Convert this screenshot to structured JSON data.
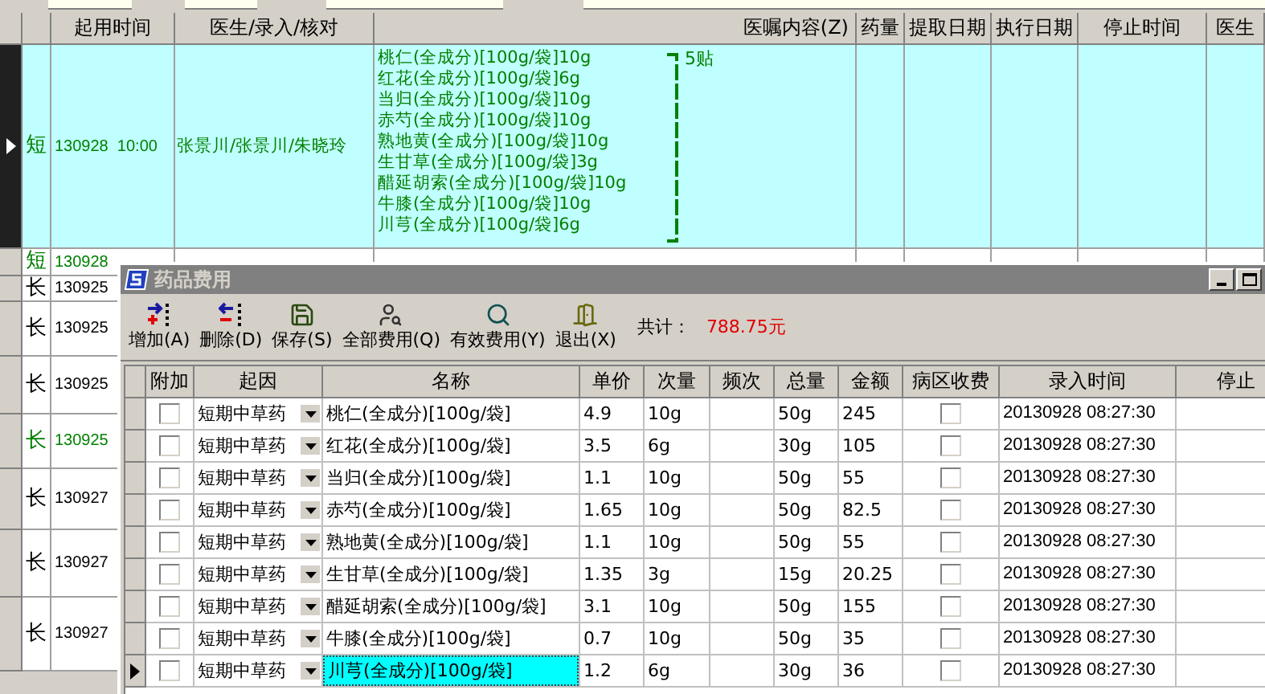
{
  "background_table": {
    "columns": [
      "起用时间",
      "医生/录入/核对",
      "医嘱内容(Z)",
      "药量",
      "提取日期",
      "执行日期",
      "停止时间",
      "医生"
    ],
    "rows": [
      {
        "selected": true,
        "color": "#008000",
        "type": "短",
        "start_time": "130928  10:00",
        "doctor": "张景川/张景川/朱晓玲",
        "content": [
          "桃仁(全成分)[100g/袋]10g",
          "红花(全成分)[100g/袋]6g",
          "当归(全成分)[100g/袋]10g",
          "赤芍(全成分)[100g/袋]10g",
          "熟地黄(全成分)[100g/袋]10g",
          "生甘草(全成分)[100g/袋]3g",
          "醋延胡索(全成分)[100g/袋]10g",
          "牛膝(全成分)[100g/袋]10g",
          "川芎(全成分)[100g/袋]6g"
        ],
        "doses": "5贴"
      },
      {
        "selected": false,
        "color": "#008000",
        "type": "短",
        "start_time": "130928"
      },
      {
        "selected": false,
        "color": "#000000",
        "type": "长",
        "start_time": "130925"
      },
      {
        "selected": false,
        "color": "#000000",
        "type": "长",
        "start_time": "130925"
      },
      {
        "selected": false,
        "color": "#000000",
        "type": "长",
        "start_time": "130925"
      },
      {
        "selected": false,
        "color": "#008000",
        "type": "长",
        "start_time": "130925"
      },
      {
        "selected": false,
        "color": "#000000",
        "type": "长",
        "start_time": "130927"
      },
      {
        "selected": false,
        "color": "#000000",
        "type": "长",
        "start_time": "130927"
      },
      {
        "selected": false,
        "color": "#000000",
        "type": "长",
        "start_time": "130927"
      }
    ]
  },
  "dialog": {
    "title": "药品费用",
    "toolbar": [
      {
        "kind": "add",
        "label": "增加(A)"
      },
      {
        "kind": "remove",
        "label": "删除(D)"
      },
      {
        "kind": "save",
        "label": "保存(S)"
      },
      {
        "kind": "all",
        "label": "全部费用(Q)"
      },
      {
        "kind": "valid",
        "label": "有效费用(Y)"
      },
      {
        "kind": "exit",
        "label": "退出(X)"
      }
    ],
    "total_label": "共计：",
    "total_value": "788.75元",
    "table": {
      "columns": [
        "附加",
        "起因",
        "名称",
        "单价",
        "次量",
        "频次",
        "总量",
        "金额",
        "病区收费",
        "录入时间",
        "停止"
      ],
      "rows": [
        {
          "selected": false,
          "attached": false,
          "cause": "短期中草药",
          "name": "桃仁(全成分)[100g/袋]",
          "price": "4.9",
          "dose": "10g",
          "total": "50g",
          "amount": "245",
          "ward_charge": false,
          "entered": "20130928 08:27:30"
        },
        {
          "selected": false,
          "attached": false,
          "cause": "短期中草药",
          "name": "红花(全成分)[100g/袋]",
          "price": "3.5",
          "dose": "6g",
          "total": "30g",
          "amount": "105",
          "ward_charge": false,
          "entered": "20130928 08:27:30"
        },
        {
          "selected": false,
          "attached": false,
          "cause": "短期中草药",
          "name": "当归(全成分)[100g/袋]",
          "price": "1.1",
          "dose": "10g",
          "total": "50g",
          "amount": "55",
          "ward_charge": false,
          "entered": "20130928 08:27:30"
        },
        {
          "selected": false,
          "attached": false,
          "cause": "短期中草药",
          "name": "赤芍(全成分)[100g/袋]",
          "price": "1.65",
          "dose": "10g",
          "total": "50g",
          "amount": "82.5",
          "ward_charge": false,
          "entered": "20130928 08:27:30"
        },
        {
          "selected": false,
          "attached": false,
          "cause": "短期中草药",
          "name": "熟地黄(全成分)[100g/袋]",
          "price": "1.1",
          "dose": "10g",
          "total": "50g",
          "amount": "55",
          "ward_charge": false,
          "entered": "20130928 08:27:30"
        },
        {
          "selected": false,
          "attached": false,
          "cause": "短期中草药",
          "name": "生甘草(全成分)[100g/袋]",
          "price": "1.35",
          "dose": "3g",
          "total": "15g",
          "amount": "20.25",
          "ward_charge": false,
          "entered": "20130928 08:27:30"
        },
        {
          "selected": false,
          "attached": false,
          "cause": "短期中草药",
          "name": "醋延胡索(全成分)[100g/袋]",
          "price": "3.1",
          "dose": "10g",
          "total": "50g",
          "amount": "155",
          "ward_charge": false,
          "entered": "20130928 08:27:30"
        },
        {
          "selected": false,
          "attached": false,
          "cause": "短期中草药",
          "name": "牛膝(全成分)[100g/袋]",
          "price": "0.7",
          "dose": "10g",
          "total": "50g",
          "amount": "35",
          "ward_charge": false,
          "entered": "20130928 08:27:30"
        },
        {
          "selected": true,
          "attached": false,
          "cause": "短期中草药",
          "name": "川芎(全成分)[100g/袋]",
          "price": "1.2",
          "dose": "6g",
          "total": "30g",
          "amount": "36",
          "ward_charge": false,
          "entered": "20130928 08:27:30"
        }
      ]
    }
  }
}
